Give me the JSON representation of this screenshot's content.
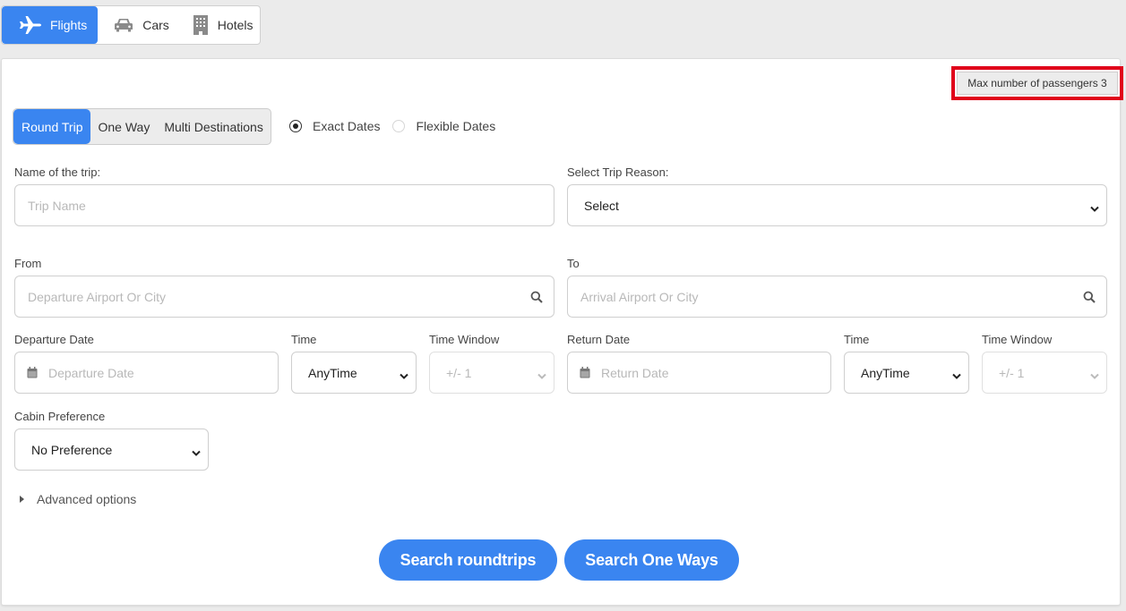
{
  "mode_tabs": [
    {
      "label": "Flights",
      "icon": "plane-icon",
      "active": true
    },
    {
      "label": "Cars",
      "icon": "car-icon",
      "active": false
    },
    {
      "label": "Hotels",
      "icon": "hotel-icon",
      "active": false
    }
  ],
  "max_passengers": "Max number of passengers 3",
  "trip_types": [
    {
      "label": "Round Trip",
      "active": true
    },
    {
      "label": "One Way",
      "active": false
    },
    {
      "label": "Multi Destinations",
      "active": false
    }
  ],
  "date_modes": [
    {
      "label": "Exact Dates",
      "checked": true
    },
    {
      "label": "Flexible Dates",
      "checked": false
    }
  ],
  "trip_name": {
    "label": "Name of the trip:",
    "placeholder": "Trip Name",
    "value": ""
  },
  "trip_reason": {
    "label": "Select Trip Reason:",
    "value": "Select"
  },
  "from": {
    "label": "From",
    "placeholder": "Departure Airport Or City",
    "value": ""
  },
  "to": {
    "label": "To",
    "placeholder": "Arrival Airport Or City",
    "value": ""
  },
  "departure": {
    "date_label": "Departure Date",
    "date_placeholder": "Departure Date",
    "time_label": "Time",
    "time_value": "AnyTime",
    "window_label": "Time Window",
    "window_value": "+/- 1"
  },
  "return": {
    "date_label": "Return Date",
    "date_placeholder": "Return Date",
    "time_label": "Time",
    "time_value": "AnyTime",
    "window_label": "Time Window",
    "window_value": "+/- 1"
  },
  "cabin": {
    "label": "Cabin Preference",
    "value": "No Preference"
  },
  "advanced_label": "Advanced options",
  "buttons": {
    "search_roundtrips": "Search roundtrips",
    "search_one_ways": "Search One Ways"
  },
  "colors": {
    "accent": "#3a85f0",
    "highlight_border": "#e0001a"
  }
}
